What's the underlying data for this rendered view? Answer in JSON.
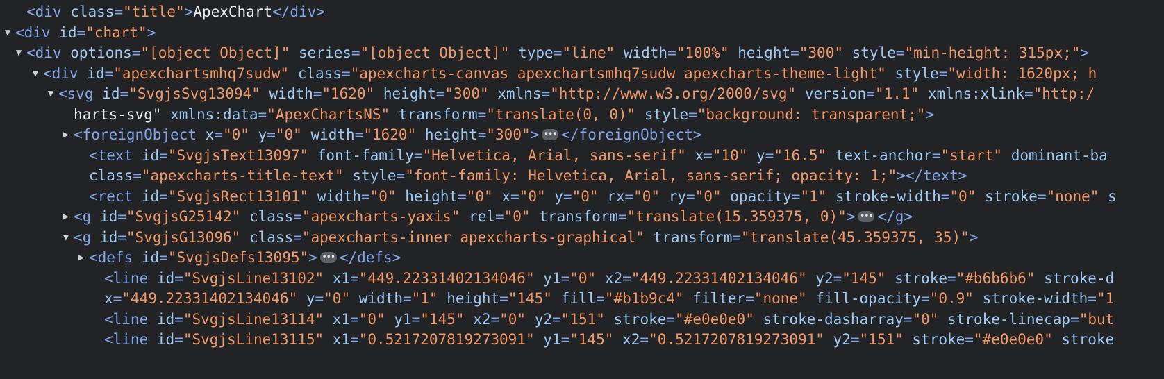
{
  "lines": [
    {
      "indent": 38,
      "tw": "",
      "html": "<span class=\"tag\">&lt;div</span> <span class=\"attr\">class</span><span class=\"punc\">=</span><span class=\"val\">\"title\"</span><span class=\"tag\">&gt;</span><span class=\"txt\">ApexChart</span><span class=\"tag\">&lt;/div&gt;</span>",
      "text": "<div class=\"title\">ApexChart</div>"
    },
    {
      "indent": 16,
      "tw": "down",
      "text": "<div id=\"chart\">"
    },
    {
      "indent": 38,
      "tw": "down",
      "text": "<div options=\"[object Object]\" series=\"[object Object]\" type=\"line\" width=\"100%\" height=\"300\" style=\"min-height: 315px;\">"
    },
    {
      "indent": 62,
      "tw": "down",
      "text": "<div id=\"apexchartsmhq7sudw\" class=\"apexcharts-canvas apexchartsmhq7sudw apexcharts-theme-light\" style=\"width: 1620px; h"
    },
    {
      "indent": 84,
      "tw": "down",
      "text": "<svg id=\"SvgjsSvg13094\" width=\"1620\" height=\"300\" xmlns=\"http://www.w3.org/2000/svg\" version=\"1.1\" xmlns:xlink=\"http:/"
    },
    {
      "indent": 106,
      "tw": "",
      "text": "harts-svg\" xmlns:data=\"ApexChartsNS\" transform=\"translate(0, 0)\" style=\"background: transparent;\">"
    },
    {
      "indent": 106,
      "tw": "right",
      "text": "<foreignObject x=\"0\" y=\"0\" width=\"1620\" height=\"300\">…</foreignObject>"
    },
    {
      "indent": 128,
      "tw": "",
      "text": "<text id=\"SvgjsText13097\" font-family=\"Helvetica, Arial, sans-serif\" x=\"10\" y=\"16.5\" text-anchor=\"start\" dominant-ba"
    },
    {
      "indent": 128,
      "tw": "",
      "text": "class=\"apexcharts-title-text\" style=\"font-family: Helvetica, Arial, sans-serif; opacity: 1;\"></text>"
    },
    {
      "indent": 128,
      "tw": "",
      "text": "<rect id=\"SvgjsRect13101\" width=\"0\" height=\"0\" x=\"0\" y=\"0\" rx=\"0\" ry=\"0\" opacity=\"1\" stroke-width=\"0\" stroke=\"none\" s"
    },
    {
      "indent": 106,
      "tw": "right",
      "text": "<g id=\"SvgjsG25142\" class=\"apexcharts-yaxis\" rel=\"0\" transform=\"translate(15.359375, 0)\">…</g>"
    },
    {
      "indent": 106,
      "tw": "down",
      "text": "<g id=\"SvgjsG13096\" class=\"apexcharts-inner apexcharts-graphical\" transform=\"translate(45.359375, 35)\">"
    },
    {
      "indent": 128,
      "tw": "right",
      "text": "<defs id=\"SvgjsDefs13095\">…</defs>"
    },
    {
      "indent": 150,
      "tw": "",
      "text": "<line id=\"SvgjsLine13102\" x1=\"449.22331402134046\" y1=\"0\" x2=\"449.22331402134046\" y2=\"145\" stroke=\"#b6b6b6\" stroke-d"
    },
    {
      "indent": 150,
      "tw": "",
      "text": "x=\"449.22331402134046\" y=\"0\" width=\"1\" height=\"145\" fill=\"#b1b9c4\" filter=\"none\" fill-opacity=\"0.9\" stroke-width=\"1"
    },
    {
      "indent": 150,
      "tw": "",
      "text": "<line id=\"SvgjsLine13114\" x1=\"0\" y1=\"145\" x2=\"0\" y2=\"151\" stroke=\"#e0e0e0\" stroke-dasharray=\"0\" stroke-linecap=\"but"
    },
    {
      "indent": 150,
      "tw": "",
      "text": "<line id=\"SvgjsLine13115\" x1=\"0.5217207819273091\" y1=\"145\" x2=\"0.5217207819273091\" y2=\"151\" stroke=\"#e0e0e0\" stroke"
    }
  ],
  "colors": {
    "background": "#222325",
    "tag": "#80a6ed",
    "attribute_name": "#9ecbf6",
    "attribute_value": "#f29766",
    "text": "#e8eaed"
  }
}
